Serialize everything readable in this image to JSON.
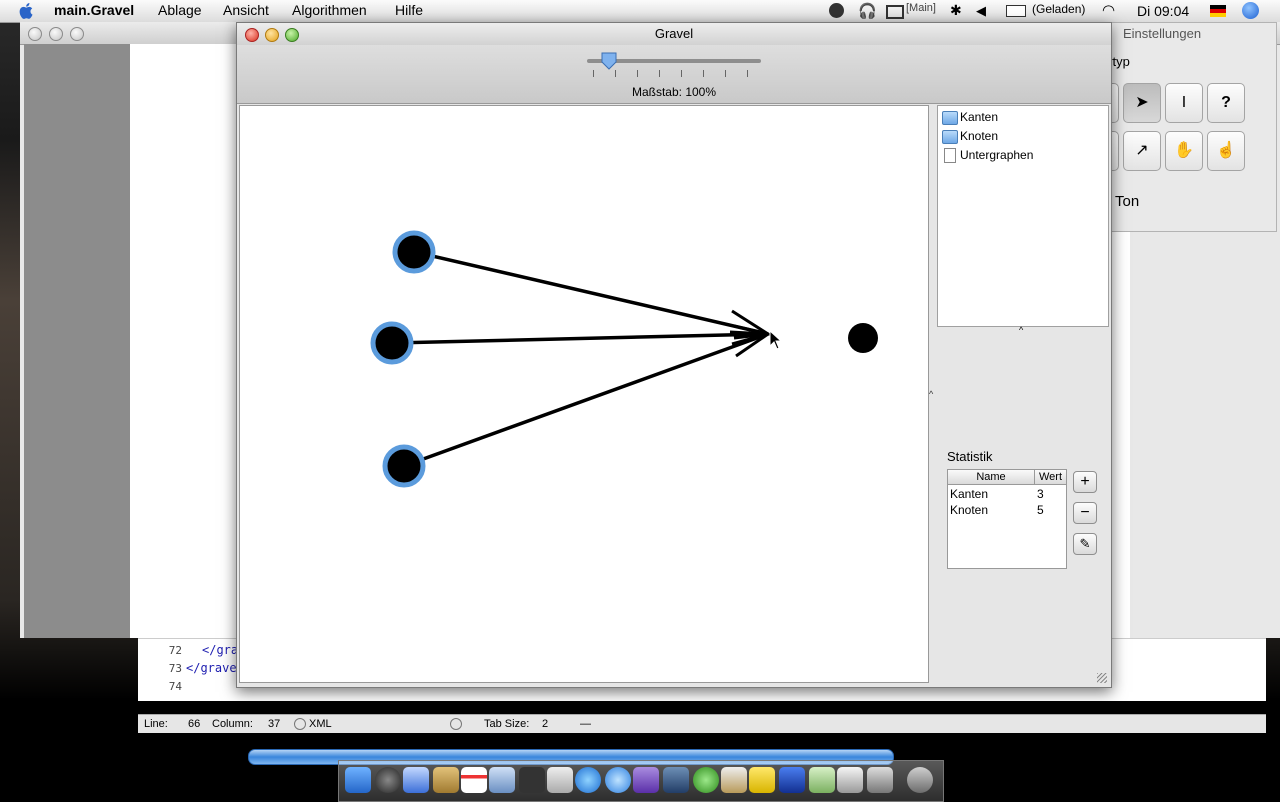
{
  "menubar": {
    "app_name": "main.Gravel",
    "items": [
      "Ablage",
      "Ansicht",
      "Algorithmen",
      "Hilfe"
    ],
    "status_main": "[Main]",
    "battery": "(Geladen)",
    "clock": "Di 09:04"
  },
  "inspector": {
    "title": "Einstellungen",
    "section_label": "ertyp",
    "ton_label": "Ton",
    "tools": [
      "←",
      "➤",
      "I",
      "?",
      "←",
      "↗",
      "✋",
      "☝"
    ]
  },
  "gravel": {
    "title": "Gravel",
    "scale_label": "Maßstab: 100%",
    "scale_value_percent": 100,
    "tree": [
      "Kanten",
      "Knoten",
      "Untergraphen"
    ],
    "stats_title": "Statistik",
    "stats_headers": [
      "Name",
      "Wert"
    ],
    "stats_rows": [
      {
        "name": "Kanten",
        "value": "3"
      },
      {
        "name": "Knoten",
        "value": "5"
      }
    ]
  },
  "editor": {
    "lines": [
      {
        "num": "72",
        "code": "</gra"
      },
      {
        "num": "73",
        "code": "</grave"
      },
      {
        "num": "74",
        "code": ""
      }
    ],
    "status": {
      "line_label": "Line:",
      "line_value": "66",
      "column_label": "Column:",
      "column_value": "37",
      "syntax": "XML",
      "tab_label": "Tab Size:",
      "tab_value": "2",
      "dash": "—"
    }
  },
  "colors": {
    "selection": "#5b9bdc",
    "scrollbar": "#3a86dc"
  }
}
